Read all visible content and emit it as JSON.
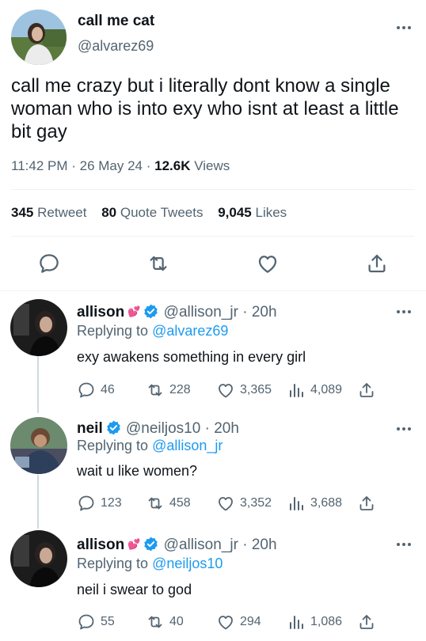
{
  "main_tweet": {
    "display_name": "call me cat",
    "handle": "@alvarez69",
    "text": "call me crazy but i literally dont know a single woman who is into exy who isnt at least a little bit gay",
    "time": "11:42 PM",
    "date": "26 May 24",
    "views_count": "12.6K",
    "views_label": "Views",
    "retweets_count": "345",
    "retweets_label": "Retweet",
    "quotes_count": "80",
    "quotes_label": "Quote Tweets",
    "likes_count": "9,045",
    "likes_label": "Likes"
  },
  "replies": [
    {
      "display_name": "allison",
      "emoji": "💕",
      "handle": "@allison_jr",
      "age": "20h",
      "replying_prefix": "Replying to",
      "replying_to": "@alvarez69",
      "text": "exy awakens something in every girl",
      "replies": "46",
      "retweets": "228",
      "likes": "3,365",
      "views": "4,089"
    },
    {
      "display_name": "neil",
      "handle": "@neiljos10",
      "age": "20h",
      "replying_prefix": "Replying to",
      "replying_to": "@allison_jr",
      "text": "wait u like women?",
      "replies": "123",
      "retweets": "458",
      "likes": "3,352",
      "views": "3,688"
    },
    {
      "display_name": "allison",
      "emoji": "💕",
      "handle": "@allison_jr",
      "age": "20h",
      "replying_prefix": "Replying to",
      "replying_to": "@neiljos10",
      "text": "neil i swear to god",
      "replies": "55",
      "retweets": "40",
      "likes": "294",
      "views": "1,086"
    }
  ],
  "icons": [
    "more-icon",
    "verified-icon",
    "reply-icon",
    "retweet-icon",
    "like-icon",
    "share-icon",
    "views-icon"
  ],
  "colors": {
    "text": "#0f1419",
    "secondary": "#536471",
    "link": "#1d9bf0",
    "divider": "#eff3f4",
    "verified": "#1d9bf0"
  }
}
